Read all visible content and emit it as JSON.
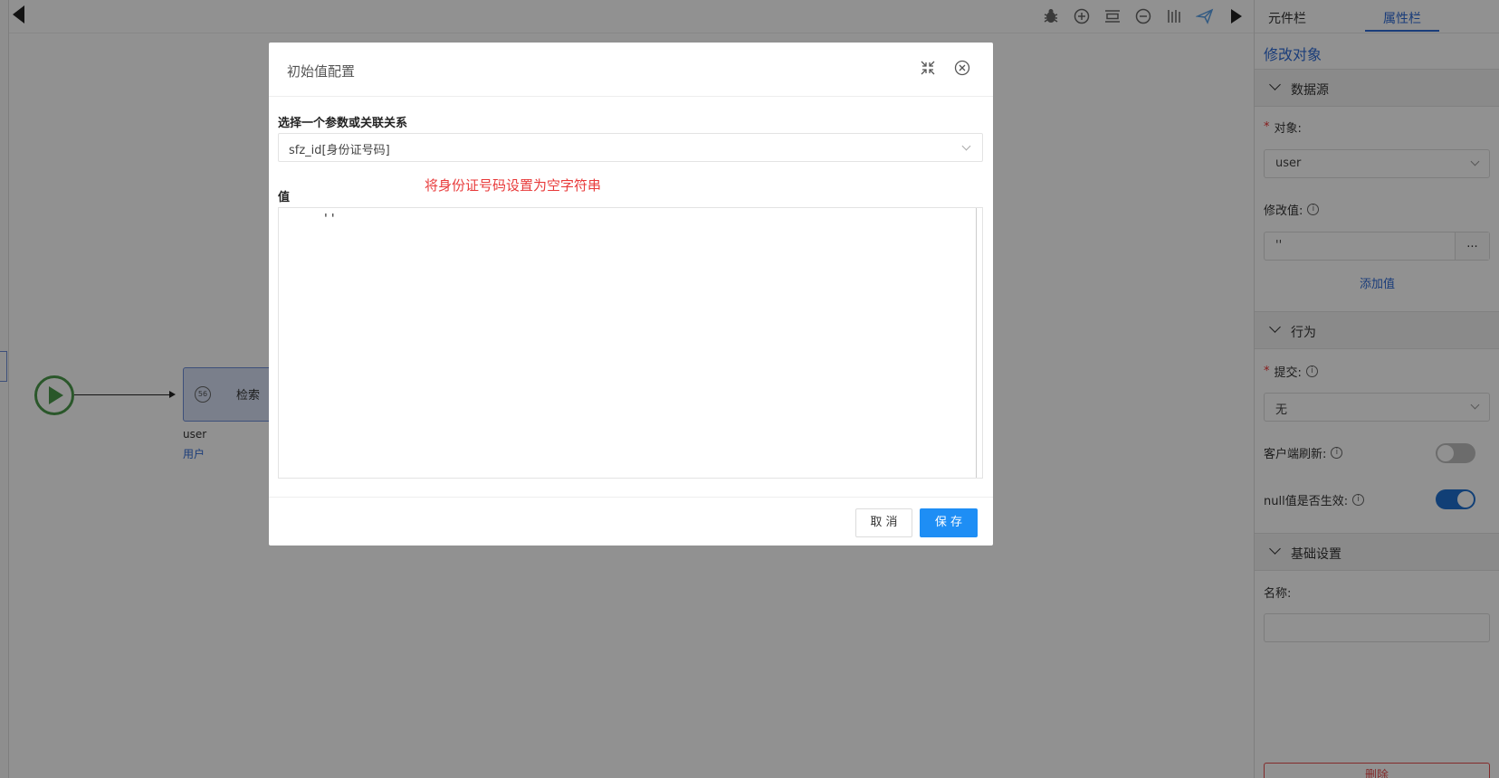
{
  "toolbar": {
    "icons": [
      "bug-icon",
      "zoom-in-icon",
      "fit-icon",
      "zoom-out-icon",
      "align-icon",
      "send-icon",
      "run-icon"
    ]
  },
  "canvas": {
    "search_node": {
      "label": "检索",
      "icon_text": "56"
    },
    "node_object": "user",
    "node_object_name": "用户"
  },
  "panel": {
    "tabs": [
      "元件栏",
      "属性栏"
    ],
    "active_tab": "属性栏",
    "title": "修改对象",
    "sections": {
      "datasource": "数据源",
      "behavior": "行为",
      "basic": "基础设置"
    },
    "fields": {
      "object_label": "对象:",
      "object_value": "user",
      "modify_label": "修改值:",
      "modify_value": "''",
      "modify_btn": "...",
      "add_value": "添加值",
      "submit_label": "提交:",
      "submit_value": "无",
      "client_refresh_label": "客户端刷新:",
      "client_refresh_on": false,
      "null_effective_label": "null值是否生效:",
      "null_effective_on": true,
      "name_label": "名称:",
      "name_value": ""
    },
    "delete_label": "删除"
  },
  "modal": {
    "title": "初始值配置",
    "param_label": "选择一个参数或关联关系",
    "param_value": "sfz_id[身份证号码]",
    "value_label": "值",
    "annotation": "将身份证号码设置为空字符串",
    "code": "''",
    "cancel": "取 消",
    "save": "保 存"
  },
  "colors": {
    "accent": "#2f6bd6",
    "primary_button": "#1e8ef5",
    "annotation": "#e83a3a",
    "start_node": "#4a9a4a",
    "switch_on": "#1f6fd0"
  }
}
